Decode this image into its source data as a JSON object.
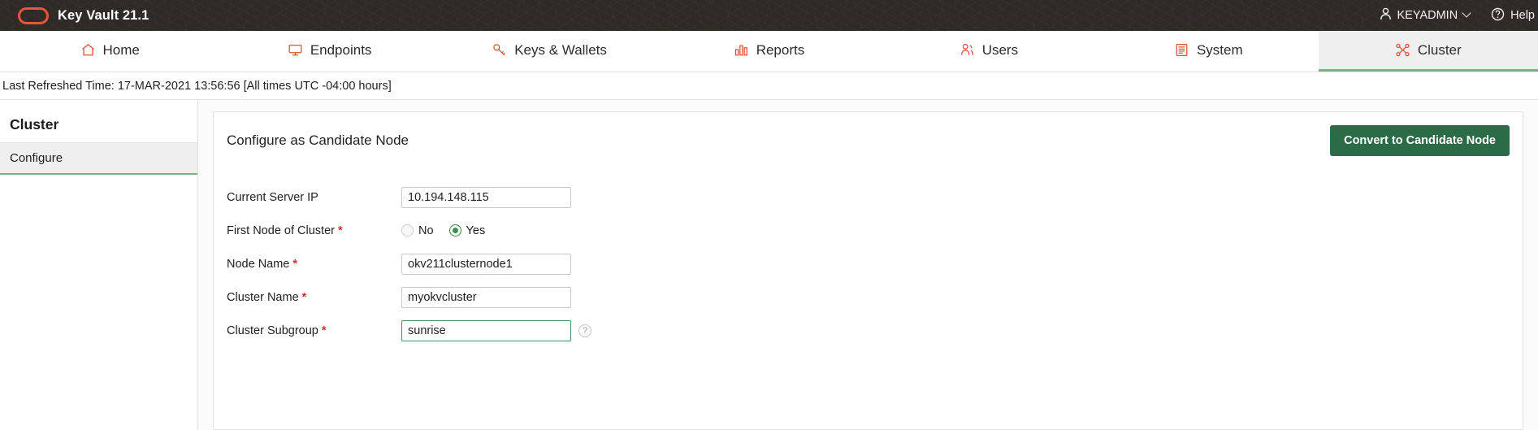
{
  "topbar": {
    "product_title": "Key Vault 21.1",
    "logo_icon": "oracle-key-vault-logo",
    "user_icon": "person-icon",
    "user_name": "KEYADMIN",
    "user_chevron_icon": "chevron-down-icon",
    "help_icon": "question-circle-icon",
    "help_label": "Help",
    "background_color": "#2e2a26",
    "accent_color": "#e8553a"
  },
  "nav": {
    "items": [
      {
        "label": "Home",
        "icon": "home-icon",
        "active": false
      },
      {
        "label": "Endpoints",
        "icon": "monitor-icon",
        "active": false
      },
      {
        "label": "Keys & Wallets",
        "icon": "key-icon",
        "active": false
      },
      {
        "label": "Reports",
        "icon": "bar-chart-icon",
        "active": false
      },
      {
        "label": "Users",
        "icon": "users-icon",
        "active": false
      },
      {
        "label": "System",
        "icon": "list-document-icon",
        "active": false
      },
      {
        "label": "Cluster",
        "icon": "cluster-nodes-icon",
        "active": true
      }
    ],
    "active_underline_color": "#7fb08a"
  },
  "status": {
    "refresh_text": "Last Refreshed Time: 17-MAR-2021 13:56:56 [All times UTC -04:00 hours]"
  },
  "sidebar": {
    "title": "Cluster",
    "items": [
      {
        "label": "Configure",
        "active": true
      }
    ]
  },
  "panel": {
    "title": "Configure as Candidate Node",
    "primary_button": {
      "label": "Convert to Candidate Node",
      "color": "#2b6b45"
    },
    "fields": [
      {
        "label": "Current Server IP",
        "required": false,
        "type": "text",
        "value": "10.194.148.115",
        "focused": false
      },
      {
        "label": "First Node of Cluster",
        "required": true,
        "type": "radio",
        "options": [
          {
            "label": "No",
            "selected": false
          },
          {
            "label": "Yes",
            "selected": true
          }
        ]
      },
      {
        "label": "Node Name",
        "required": true,
        "type": "text",
        "value": "okv211clusternode1",
        "focused": false
      },
      {
        "label": "Cluster Name",
        "required": true,
        "type": "text",
        "value": "myokvcluster",
        "focused": false
      },
      {
        "label": "Cluster Subgroup",
        "required": true,
        "type": "text",
        "value": "sunrise",
        "focused": true,
        "help_icon": "question-mark-icon"
      }
    ]
  }
}
